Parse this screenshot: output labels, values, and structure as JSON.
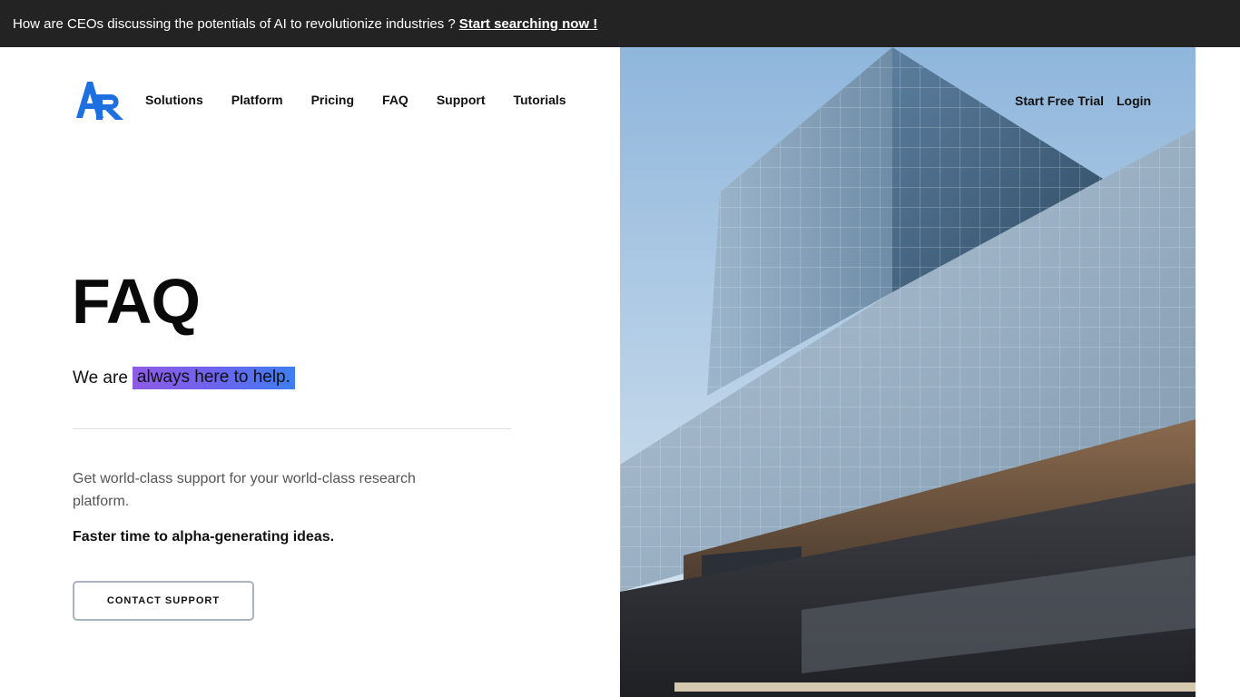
{
  "announcement": {
    "text": "How are CEOs discussing the potentials of AI to revolutionize industries ?",
    "link": "Start searching now !"
  },
  "brand": {
    "logo_letters": "AR",
    "accent": "#1e6fe0"
  },
  "nav": {
    "items": [
      "Solutions",
      "Platform",
      "Pricing",
      "FAQ",
      "Support",
      "Tutorials"
    ],
    "trial": "Start Free Trial",
    "login": "Login"
  },
  "hero": {
    "title": "FAQ",
    "tagline_prefix": "We are",
    "tagline_highlight": "always here to help.",
    "description": "Get world-class support for your world-class research platform.",
    "strong": "Faster time to alpha-generating ideas.",
    "cta": "CONTACT SUPPORT"
  },
  "colors": {
    "announcement_bg": "#232323",
    "highlight_start": "#8e5ce6",
    "highlight_end": "#3d7ef2"
  },
  "icons": {
    "logo": "ar-logo-icon"
  }
}
